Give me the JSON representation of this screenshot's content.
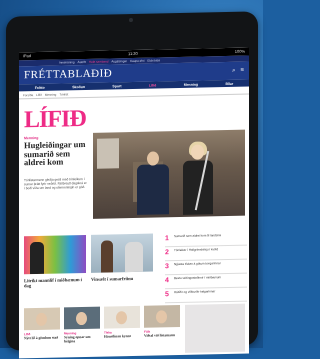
{
  "status_bar": {
    "left": "iPad",
    "time": "11:20",
    "right": "100%"
  },
  "top_nav": [
    "Innskráning",
    "Áskrift",
    "Hafa samband",
    "Auglýsingar",
    "Kaupa efni",
    "Eldri blöð"
  ],
  "masthead": {
    "logo": "FRÉTTABLAÐIÐ"
  },
  "categories": [
    "Fréttir",
    "Skoðun",
    "Sport",
    "Lífið",
    "Menning",
    "Bílar"
  ],
  "breadcrumb": [
    "Forsíða",
    "Lífið",
    "Menning",
    "Tónlist"
  ],
  "section": {
    "logo": "LÍFIÐ"
  },
  "lead": {
    "kicker": "Menning",
    "title": "Hugleiðingar um sumarið sem aldrei kom",
    "text": "Tónlistarmenn gleðja gesti með tónleikum í sumar þrátt fyrir veðrið. Fjölbreytt dagskrá er í boði víða um land og stemmningin er góð."
  },
  "feature_captions": [
    "Litríkt mannlíf í miðbænum í dag",
    "Vinsælt í sumarfríinu"
  ],
  "toplist": [
    {
      "num": "1",
      "text": "Sumarið sem aldrei kom til landsins"
    },
    {
      "num": "2",
      "text": "Tónleikar í Hallgrímskirkju í kvöld"
    },
    {
      "num": "3",
      "text": "Nýjasta tískan á götum borgarinnar"
    },
    {
      "num": "4",
      "text": "Bestu veitingastaðirnir í miðbænum"
    },
    {
      "num": "5",
      "text": "Hátíðir og viðburðir helgarinnar"
    }
  ],
  "mini_articles": [
    {
      "kicker": "Lífið",
      "title": "Nýtt líf á gömlum stað"
    },
    {
      "kicker": "Menning",
      "title": "Sýning opnar um helgina"
    },
    {
      "kicker": "Tíska",
      "title": "Haustlínan kynnt"
    },
    {
      "kicker": "Fólk",
      "title": "Viðtal við listamann"
    }
  ]
}
